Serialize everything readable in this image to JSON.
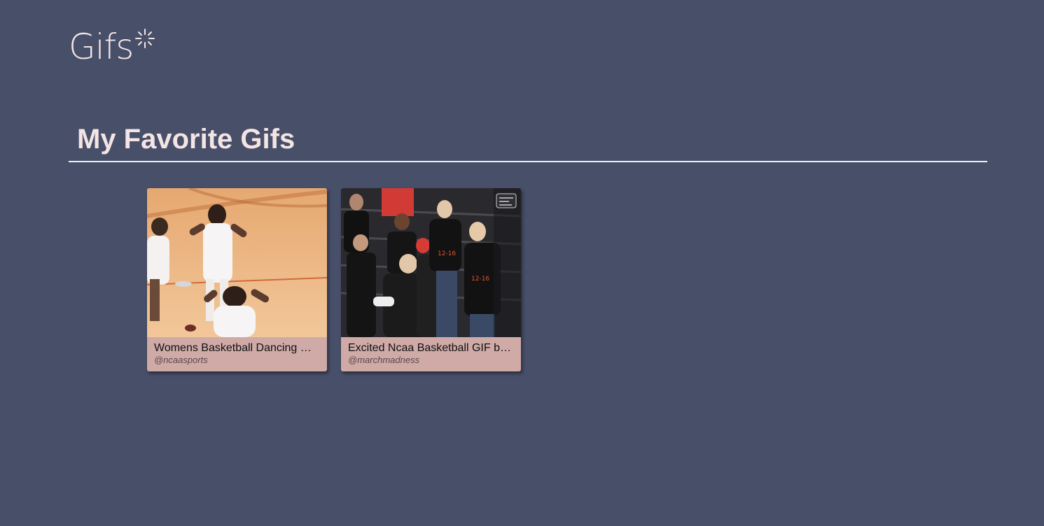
{
  "header": {
    "logo_text": "Gifs",
    "logo_icon": "sparkle-icon",
    "logo_color": "#f4e4e4"
  },
  "main": {
    "title": "My Favorite Gifs"
  },
  "gifs": [
    {
      "title": "Womens Basketball Dancing GIF by NCAA Championships",
      "title_display": "Womens Basketball Dancing GI…",
      "username": "@ncaasports"
    },
    {
      "title": "Excited Ncaa Basketball GIF by NCAA March Madness",
      "title_display": "Excited Ncaa Basketball GIF by …",
      "username": "@marchmadness"
    }
  ],
  "colors": {
    "background": "#474f69",
    "card": "#cfaaa7",
    "accent": "#f4e4e4"
  }
}
